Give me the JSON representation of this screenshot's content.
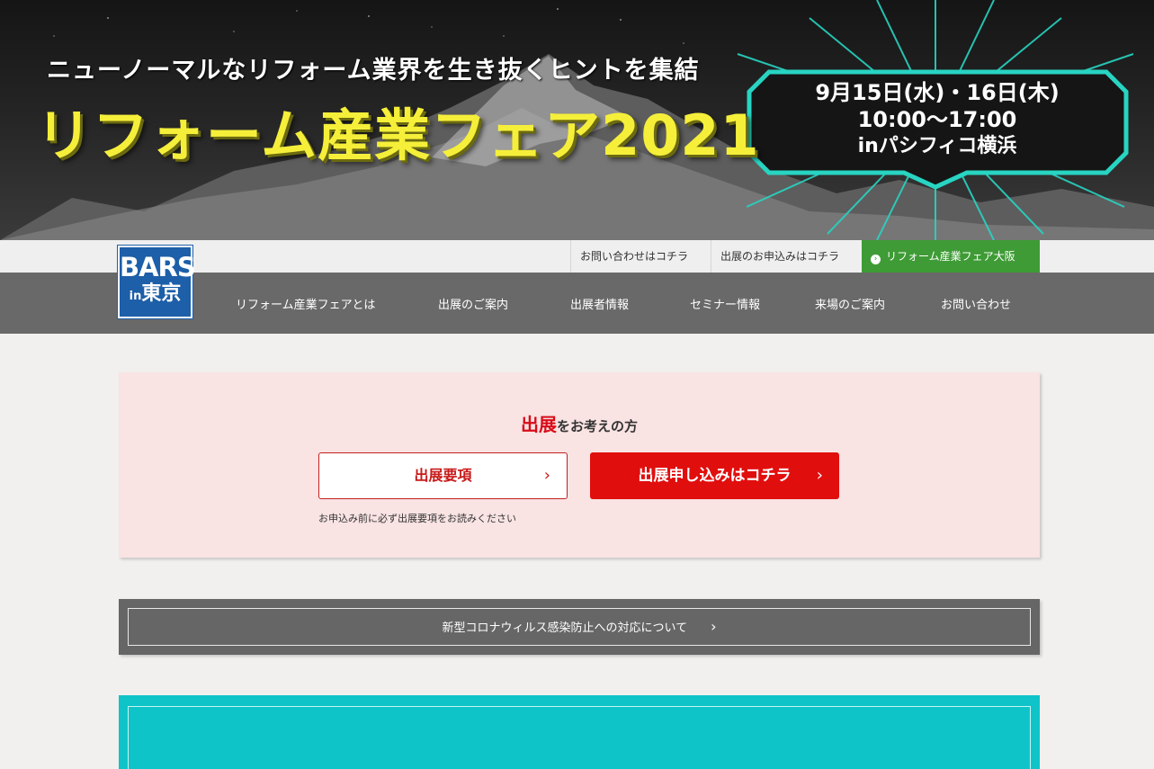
{
  "hero": {
    "tagline": "ニューノーマルなリフォーム業界を生き抜くヒントを集結",
    "title": "リフォーム産業フェア2021",
    "date": "9月15日(水)・16日(木)",
    "time": "10:00〜17:00",
    "venue": "inパシフィコ横浜"
  },
  "top_links": {
    "contact": "お問い合わせはコチラ",
    "apply": "出展のお申込みはコチラ",
    "osaka": "リフォーム産業フェア大阪"
  },
  "logo": {
    "line1": "BARS",
    "line2_prefix": "in",
    "line2": "東京"
  },
  "nav": {
    "items": [
      "リフォーム産業フェアとは",
      "出展のご案内",
      "出展者情報",
      "セミナー情報",
      "来場のご案内",
      "お問い合わせ"
    ]
  },
  "exhibit": {
    "heading_strong": "出展",
    "heading_rest": "をお考えの方",
    "btn_guidelines": "出展要項",
    "btn_apply": "出展申し込みはコチラ",
    "note": "お申込み前に必ず出展要項をお読みください"
  },
  "corona": {
    "link": "新型コロナウィルス感染防止への対応について"
  },
  "colors": {
    "accent_red": "#e10e0e",
    "osaka_green": "#3e9b35",
    "nav_gray": "#696969",
    "title_yellow": "#f5ef3a",
    "teal": "#0ec4c9"
  }
}
